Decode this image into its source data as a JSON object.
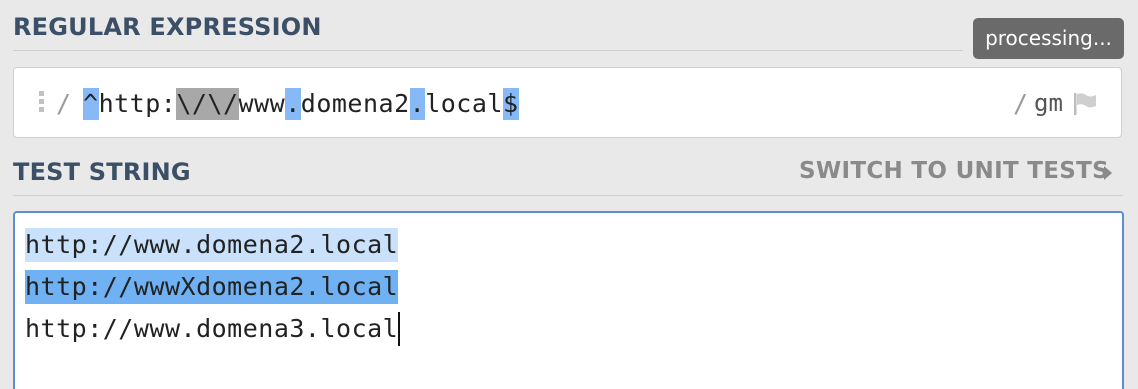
{
  "regex_section": {
    "title": "REGULAR EXPRESSION",
    "status_badge": "processing...",
    "open_delimiter": "/",
    "close_delimiter": "/",
    "flags": "gm",
    "tokens": {
      "t1": "^",
      "t2": "http:",
      "t3": "\\/\\/",
      "t4": "www",
      "t5": ".",
      "t6": "domena2",
      "t7": ".",
      "t8": "local",
      "t9": "$"
    },
    "icons": {
      "drag": "drag-handle-icon",
      "flag": "flag-icon"
    }
  },
  "test_section": {
    "title": "TEST STRING",
    "switch_label": "SWITCH TO UNIT TESTS",
    "lines": [
      "http://www.domena2.local",
      "http://wwwXdomena2.local",
      "http://www.domena3.local"
    ]
  },
  "colors": {
    "title": "#3b4f66",
    "match_light": "#c9e1fb",
    "match_dark": "#6fb1f2",
    "token_meta": "#86b9f5",
    "token_escape": "#a8a8a8",
    "focus_border": "#5b8fd0",
    "badge_bg": "#6a6a6a"
  }
}
